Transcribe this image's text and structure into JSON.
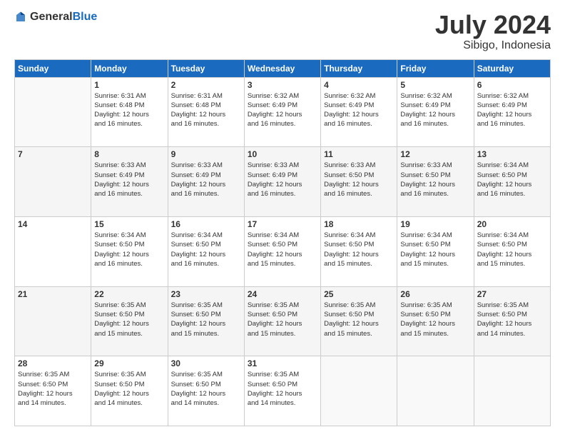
{
  "logo": {
    "general": "General",
    "blue": "Blue"
  },
  "title": "July 2024",
  "location": "Sibigo, Indonesia",
  "days_header": [
    "Sunday",
    "Monday",
    "Tuesday",
    "Wednesday",
    "Thursday",
    "Friday",
    "Saturday"
  ],
  "weeks": [
    [
      {
        "day": "",
        "info": ""
      },
      {
        "day": "1",
        "info": "Sunrise: 6:31 AM\nSunset: 6:48 PM\nDaylight: 12 hours\nand 16 minutes."
      },
      {
        "day": "2",
        "info": "Sunrise: 6:31 AM\nSunset: 6:48 PM\nDaylight: 12 hours\nand 16 minutes."
      },
      {
        "day": "3",
        "info": "Sunrise: 6:32 AM\nSunset: 6:49 PM\nDaylight: 12 hours\nand 16 minutes."
      },
      {
        "day": "4",
        "info": "Sunrise: 6:32 AM\nSunset: 6:49 PM\nDaylight: 12 hours\nand 16 minutes."
      },
      {
        "day": "5",
        "info": "Sunrise: 6:32 AM\nSunset: 6:49 PM\nDaylight: 12 hours\nand 16 minutes."
      },
      {
        "day": "6",
        "info": "Sunrise: 6:32 AM\nSunset: 6:49 PM\nDaylight: 12 hours\nand 16 minutes."
      }
    ],
    [
      {
        "day": "7",
        "info": ""
      },
      {
        "day": "8",
        "info": "Sunrise: 6:33 AM\nSunset: 6:49 PM\nDaylight: 12 hours\nand 16 minutes."
      },
      {
        "day": "9",
        "info": "Sunrise: 6:33 AM\nSunset: 6:49 PM\nDaylight: 12 hours\nand 16 minutes."
      },
      {
        "day": "10",
        "info": "Sunrise: 6:33 AM\nSunset: 6:49 PM\nDaylight: 12 hours\nand 16 minutes."
      },
      {
        "day": "11",
        "info": "Sunrise: 6:33 AM\nSunset: 6:50 PM\nDaylight: 12 hours\nand 16 minutes."
      },
      {
        "day": "12",
        "info": "Sunrise: 6:33 AM\nSunset: 6:50 PM\nDaylight: 12 hours\nand 16 minutes."
      },
      {
        "day": "13",
        "info": "Sunrise: 6:34 AM\nSunset: 6:50 PM\nDaylight: 12 hours\nand 16 minutes."
      }
    ],
    [
      {
        "day": "14",
        "info": ""
      },
      {
        "day": "15",
        "info": "Sunrise: 6:34 AM\nSunset: 6:50 PM\nDaylight: 12 hours\nand 16 minutes."
      },
      {
        "day": "16",
        "info": "Sunrise: 6:34 AM\nSunset: 6:50 PM\nDaylight: 12 hours\nand 16 minutes."
      },
      {
        "day": "17",
        "info": "Sunrise: 6:34 AM\nSunset: 6:50 PM\nDaylight: 12 hours\nand 15 minutes."
      },
      {
        "day": "18",
        "info": "Sunrise: 6:34 AM\nSunset: 6:50 PM\nDaylight: 12 hours\nand 15 minutes."
      },
      {
        "day": "19",
        "info": "Sunrise: 6:34 AM\nSunset: 6:50 PM\nDaylight: 12 hours\nand 15 minutes."
      },
      {
        "day": "20",
        "info": "Sunrise: 6:34 AM\nSunset: 6:50 PM\nDaylight: 12 hours\nand 15 minutes."
      }
    ],
    [
      {
        "day": "21",
        "info": ""
      },
      {
        "day": "22",
        "info": "Sunrise: 6:35 AM\nSunset: 6:50 PM\nDaylight: 12 hours\nand 15 minutes."
      },
      {
        "day": "23",
        "info": "Sunrise: 6:35 AM\nSunset: 6:50 PM\nDaylight: 12 hours\nand 15 minutes."
      },
      {
        "day": "24",
        "info": "Sunrise: 6:35 AM\nSunset: 6:50 PM\nDaylight: 12 hours\nand 15 minutes."
      },
      {
        "day": "25",
        "info": "Sunrise: 6:35 AM\nSunset: 6:50 PM\nDaylight: 12 hours\nand 15 minutes."
      },
      {
        "day": "26",
        "info": "Sunrise: 6:35 AM\nSunset: 6:50 PM\nDaylight: 12 hours\nand 15 minutes."
      },
      {
        "day": "27",
        "info": "Sunrise: 6:35 AM\nSunset: 6:50 PM\nDaylight: 12 hours\nand 14 minutes."
      }
    ],
    [
      {
        "day": "28",
        "info": "Sunrise: 6:35 AM\nSunset: 6:50 PM\nDaylight: 12 hours\nand 14 minutes."
      },
      {
        "day": "29",
        "info": "Sunrise: 6:35 AM\nSunset: 6:50 PM\nDaylight: 12 hours\nand 14 minutes."
      },
      {
        "day": "30",
        "info": "Sunrise: 6:35 AM\nSunset: 6:50 PM\nDaylight: 12 hours\nand 14 minutes."
      },
      {
        "day": "31",
        "info": "Sunrise: 6:35 AM\nSunset: 6:50 PM\nDaylight: 12 hours\nand 14 minutes."
      },
      {
        "day": "",
        "info": ""
      },
      {
        "day": "",
        "info": ""
      },
      {
        "day": "",
        "info": ""
      }
    ]
  ]
}
